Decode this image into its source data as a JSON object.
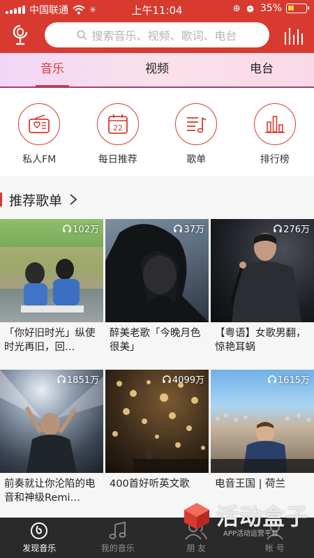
{
  "status_bar": {
    "carrier": "中国联通",
    "time": "上午11:04",
    "battery": "35%",
    "battery_level": 0.35
  },
  "header": {
    "search_placeholder": "搜索音乐、视频、歌词、电台"
  },
  "tabs": [
    {
      "label": "音乐",
      "active": true
    },
    {
      "label": "视频",
      "active": false
    },
    {
      "label": "电台",
      "active": false
    }
  ],
  "quick": [
    {
      "label": "私人FM",
      "icon": "radio-icon"
    },
    {
      "label": "每日推荐",
      "icon": "calendar-icon",
      "day": "22"
    },
    {
      "label": "歌单",
      "icon": "playlist-icon"
    },
    {
      "label": "排行榜",
      "icon": "chart-icon"
    }
  ],
  "section": {
    "title": "推荐歌单"
  },
  "playlists": [
    {
      "count": "102万",
      "caption": "「你好旧时光」纵使时光再旧，回…"
    },
    {
      "count": "37万",
      "caption": "醉美老歌「今晚月色很美」"
    },
    {
      "count": "276万",
      "caption": "【粤语】女歌男翻，惊艳耳蜗"
    },
    {
      "count": "1851万",
      "caption": "前奏就让你沦陷的电音和神级Remi…"
    },
    {
      "count": "4099万",
      "caption": "400首好听英文歌"
    },
    {
      "count": "1615万",
      "caption": "电音王国 | 荷兰"
    }
  ],
  "bottom_nav": [
    {
      "label": "发现音乐",
      "active": true
    },
    {
      "label": "我的音乐",
      "active": false
    },
    {
      "label": "朋 友",
      "active": false
    },
    {
      "label": "帐 号",
      "active": false
    }
  ],
  "watermark": {
    "text": "活动盒子",
    "sub": "APP活动运营平台"
  },
  "colors": {
    "accent": "#d83a30",
    "nav_bg": "#2a2a2a"
  }
}
